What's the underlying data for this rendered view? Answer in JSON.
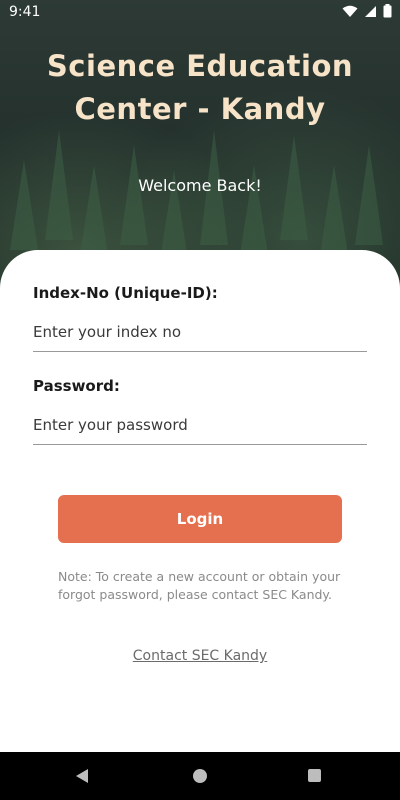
{
  "status_bar": {
    "time": "9:41",
    "icons": [
      "wifi-icon",
      "signal-icon",
      "battery-icon"
    ]
  },
  "header": {
    "title_line1": "Science Education",
    "title_line2": "Center - Kandy",
    "welcome": "Welcome Back!"
  },
  "form": {
    "index_label": "Index-No (Unique-ID):",
    "index_placeholder": "Enter your index no",
    "password_label": "Password:",
    "password_placeholder": "Enter your password",
    "login_label": "Login"
  },
  "note": "Note: To create a new account or obtain your forgot password, please contact SEC Kandy.",
  "contact_link": "Contact SEC Kandy",
  "colors": {
    "accent": "#e5704f",
    "title": "#f6e3c8",
    "hero_bg": "#26332f"
  },
  "nav_bar": {
    "icons": [
      "back-icon",
      "home-icon",
      "recents-icon"
    ]
  }
}
